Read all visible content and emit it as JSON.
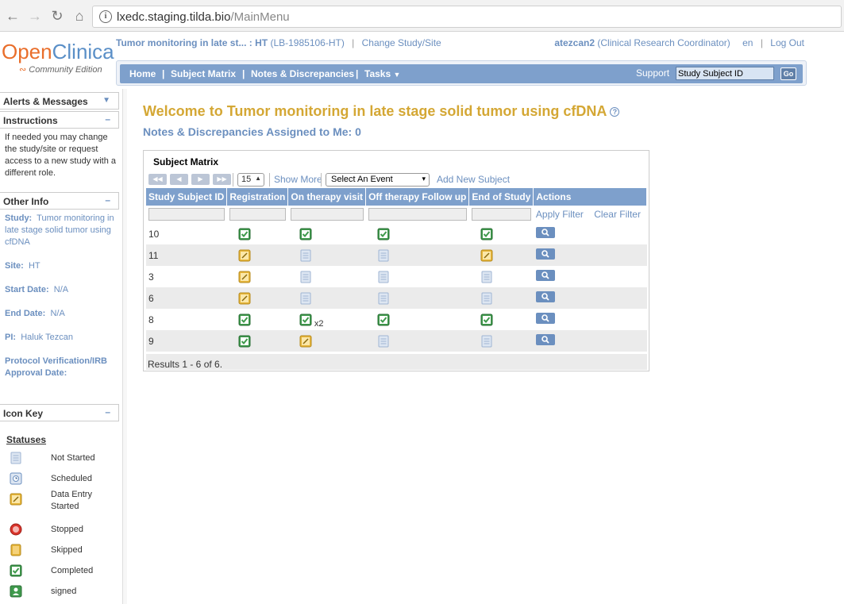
{
  "browser": {
    "url_host": "lxedc.staging.tilda.bio",
    "url_path": "/MainMenu"
  },
  "logo": {
    "open": "Open",
    "clinica": "Clinica",
    "edition": "Community Edition"
  },
  "header": {
    "study_name": "Tumor monitoring in late st... : HT",
    "study_id": "(LB-1985106-HT)",
    "change_study": "Change Study/Site",
    "user": "atezcan2",
    "role": "(Clinical Research Coordinator)",
    "lang": "en",
    "logout": "Log Out"
  },
  "nav": {
    "home": "Home",
    "subject_matrix": "Subject Matrix",
    "notes": "Notes & Discrepancies",
    "tasks": "Tasks",
    "support": "Support",
    "search_value": "Study Subject ID",
    "go": "Go"
  },
  "sidebar": {
    "alerts": "Alerts & Messages",
    "instructions": "Instructions",
    "instructions_text": "If needed you may change the study/site or request access to a new study with a different role.",
    "other_info": "Other Info",
    "study_label": "Study:",
    "study_value": "Tumor monitoring in late stage solid tumor using cfDNA",
    "site_label": "Site:",
    "site_value": "HT",
    "start_label": "Start Date:",
    "start_value": "N/A",
    "end_label": "End Date:",
    "end_value": "N/A",
    "pi_label": "PI:",
    "pi_value": "Haluk Tezcan",
    "protocol_label": "Protocol Verification/IRB Approval Date:",
    "icon_key": "Icon Key",
    "statuses": "Statuses",
    "status_items": [
      {
        "icon": "not-started-icon",
        "label": "Not Started"
      },
      {
        "icon": "scheduled-icon",
        "label": "Scheduled"
      },
      {
        "icon": "data-entry-started-icon",
        "label": "Data Entry Started"
      },
      {
        "icon": "stopped-icon",
        "label": "Stopped"
      },
      {
        "icon": "skipped-icon",
        "label": "Skipped"
      },
      {
        "icon": "completed-icon",
        "label": "Completed"
      },
      {
        "icon": "signed-icon",
        "label": "signed"
      }
    ]
  },
  "main": {
    "welcome": "Welcome to Tumor monitoring in late stage solid tumor using cfDNA",
    "notes_assigned": "Notes & Discrepancies Assigned to Me: 0",
    "matrix_title": "Subject Matrix",
    "page_size": "15",
    "show_more": "Show More",
    "select_event": "Select An Event",
    "add_new_subject": "Add New Subject",
    "apply_filter": "Apply Filter",
    "clear_filter": "Clear Filter",
    "results": "Results 1 - 6 of 6."
  },
  "table": {
    "columns": [
      "Study Subject ID",
      "Registration",
      "On therapy visit",
      "Off therapy Follow up",
      "End of Study",
      "Actions"
    ],
    "rows": [
      {
        "id": "10",
        "cells": [
          "completed",
          "completed",
          "completed",
          "completed"
        ],
        "extra": ""
      },
      {
        "id": "11",
        "cells": [
          "started",
          "notstarted",
          "notstarted",
          "started"
        ],
        "extra": ""
      },
      {
        "id": "3",
        "cells": [
          "started",
          "notstarted",
          "notstarted",
          "notstarted"
        ],
        "extra": ""
      },
      {
        "id": "6",
        "cells": [
          "started",
          "notstarted",
          "notstarted",
          "notstarted"
        ],
        "extra": ""
      },
      {
        "id": "8",
        "cells": [
          "completed",
          "completed",
          "completed",
          "completed"
        ],
        "extra": "x2"
      },
      {
        "id": "9",
        "cells": [
          "completed",
          "started",
          "notstarted",
          "notstarted"
        ],
        "extra": ""
      }
    ]
  },
  "colors": {
    "accent_blue": "#7ea0cc",
    "link_blue": "#6b8fbf",
    "title_gold": "#d4a734",
    "completed_green": "#3f9a4c",
    "started_yellow": "#e6b53a",
    "notstarted_blue": "#9fb4d3"
  }
}
